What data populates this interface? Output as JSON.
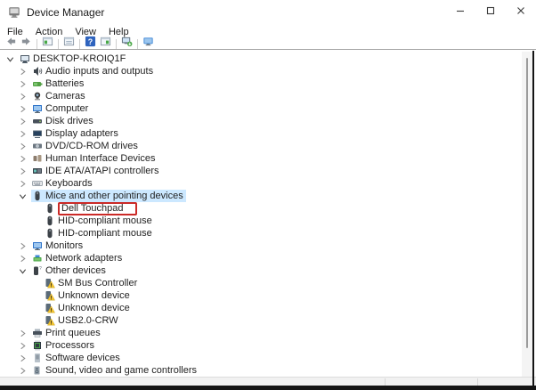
{
  "window": {
    "title": "Device Manager",
    "app_icon": "device-manager-app-icon",
    "controls": [
      {
        "name": "minimize",
        "icon": "minimize-icon"
      },
      {
        "name": "maximize",
        "icon": "maximize-icon"
      },
      {
        "name": "close",
        "icon": "close-icon"
      }
    ]
  },
  "menu": {
    "items": [
      {
        "label": "File"
      },
      {
        "label": "Action"
      },
      {
        "label": "View"
      },
      {
        "label": "Help"
      }
    ]
  },
  "toolbar": {
    "items": [
      {
        "name": "back",
        "icon": "back-arrow-icon"
      },
      {
        "name": "forward",
        "icon": "forward-arrow-icon"
      },
      {
        "separator": true
      },
      {
        "name": "show-console-tree",
        "icon": "console-tree-icon"
      },
      {
        "separator": true
      },
      {
        "name": "properties",
        "icon": "properties-icon"
      },
      {
        "separator": true
      },
      {
        "name": "help",
        "icon": "help-icon"
      },
      {
        "name": "show-action-pane",
        "icon": "action-pane-icon"
      },
      {
        "separator": true
      },
      {
        "name": "scan-hardware-changes",
        "icon": "scan-hardware-icon"
      },
      {
        "separator": true
      },
      {
        "name": "devices",
        "icon": "devices-icon"
      }
    ]
  },
  "tree": {
    "rows": [
      {
        "label": "DESKTOP-KROIQ1F",
        "level": 0,
        "state": "expanded",
        "icon": "computer-icon",
        "selected": false,
        "annotated": false
      },
      {
        "label": "Audio inputs and outputs",
        "level": 1,
        "state": "collapsed",
        "icon": "audio-icon",
        "selected": false,
        "annotated": false
      },
      {
        "label": "Batteries",
        "level": 1,
        "state": "collapsed",
        "icon": "battery-icon",
        "selected": false,
        "annotated": false
      },
      {
        "label": "Cameras",
        "level": 1,
        "state": "collapsed",
        "icon": "camera-icon",
        "selected": false,
        "annotated": false
      },
      {
        "label": "Computer",
        "level": 1,
        "state": "collapsed",
        "icon": "monitor-icon",
        "selected": false,
        "annotated": false
      },
      {
        "label": "Disk drives",
        "level": 1,
        "state": "collapsed",
        "icon": "disk-icon",
        "selected": false,
        "annotated": false
      },
      {
        "label": "Display adapters",
        "level": 1,
        "state": "collapsed",
        "icon": "display-icon",
        "selected": false,
        "annotated": false
      },
      {
        "label": "DVD/CD-ROM drives",
        "level": 1,
        "state": "collapsed",
        "icon": "dvd-icon",
        "selected": false,
        "annotated": false
      },
      {
        "label": "Human Interface Devices",
        "level": 1,
        "state": "collapsed",
        "icon": "hid-icon",
        "selected": false,
        "annotated": false
      },
      {
        "label": "IDE ATA/ATAPI controllers",
        "level": 1,
        "state": "collapsed",
        "icon": "ide-icon",
        "selected": false,
        "annotated": false
      },
      {
        "label": "Keyboards",
        "level": 1,
        "state": "collapsed",
        "icon": "keyboard-icon",
        "selected": false,
        "annotated": false
      },
      {
        "label": "Mice and other pointing devices",
        "level": 1,
        "state": "expanded",
        "icon": "mouse-icon",
        "selected": true,
        "annotated": false
      },
      {
        "label": "Dell Touchpad",
        "level": 2,
        "state": "none",
        "icon": "mouse-icon",
        "selected": false,
        "annotated": true
      },
      {
        "label": "HID-compliant mouse",
        "level": 2,
        "state": "none",
        "icon": "mouse-icon",
        "selected": false,
        "annotated": false
      },
      {
        "label": "HID-compliant mouse",
        "level": 2,
        "state": "none",
        "icon": "mouse-icon",
        "selected": false,
        "annotated": false
      },
      {
        "label": "Monitors",
        "level": 1,
        "state": "collapsed",
        "icon": "monitor-icon",
        "selected": false,
        "annotated": false
      },
      {
        "label": "Network adapters",
        "level": 1,
        "state": "collapsed",
        "icon": "network-icon",
        "selected": false,
        "annotated": false
      },
      {
        "label": "Other devices",
        "level": 1,
        "state": "expanded",
        "icon": "unknown-device-icon",
        "selected": false,
        "annotated": false
      },
      {
        "label": "SM Bus Controller",
        "level": 2,
        "state": "none",
        "icon": "warning-icon",
        "selected": false,
        "annotated": false
      },
      {
        "label": "Unknown device",
        "level": 2,
        "state": "none",
        "icon": "warning-icon",
        "selected": false,
        "annotated": false
      },
      {
        "label": "Unknown device",
        "level": 2,
        "state": "none",
        "icon": "warning-icon",
        "selected": false,
        "annotated": false
      },
      {
        "label": "USB2.0-CRW",
        "level": 2,
        "state": "none",
        "icon": "warning-icon",
        "selected": false,
        "annotated": false
      },
      {
        "label": "Print queues",
        "level": 1,
        "state": "collapsed",
        "icon": "printer-icon",
        "selected": false,
        "annotated": false
      },
      {
        "label": "Processors",
        "level": 1,
        "state": "collapsed",
        "icon": "cpu-icon",
        "selected": false,
        "annotated": false
      },
      {
        "label": "Software devices",
        "level": 1,
        "state": "collapsed",
        "icon": "software-icon",
        "selected": false,
        "annotated": false
      },
      {
        "label": "Sound, video and game controllers",
        "level": 1,
        "state": "collapsed",
        "icon": "sound-icon",
        "selected": false,
        "annotated": false
      }
    ]
  },
  "colors": {
    "selection_highlight": "#cce8ff",
    "annotation_red": "#cb2a27",
    "warning_yellow": "#f2c330",
    "help_blue": "#2e63be"
  }
}
